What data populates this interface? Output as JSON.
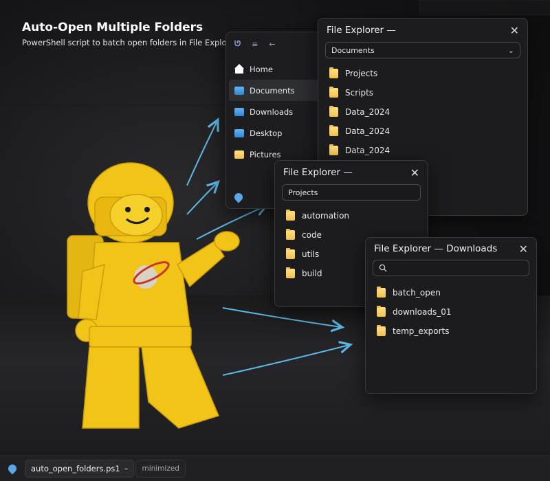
{
  "header": {
    "title": "Auto-Open Multiple Folders",
    "subtitle": "PowerShell script to batch open folders in File Explorer"
  },
  "sidebar": {
    "items": [
      {
        "label": "Home",
        "icon": "home-icon"
      },
      {
        "label": "Documents",
        "icon": "folder-icon"
      },
      {
        "label": "Downloads",
        "icon": "folder-icon"
      },
      {
        "label": "Desktop",
        "icon": "folder-icon"
      },
      {
        "label": "Pictures",
        "icon": "folder-icon"
      }
    ],
    "active": "Documents"
  },
  "win1": {
    "title": "File Explorer —",
    "address": "Documents",
    "items": [
      "Projects",
      "Scripts",
      "Data_2024",
      "Data_2024",
      "Data_2024"
    ]
  },
  "win2": {
    "title": "File Explorer —",
    "address": "Projects",
    "items": [
      "automation",
      "code",
      "utils",
      "build"
    ]
  },
  "win3": {
    "title": "File Explorer — Downloads",
    "address": "",
    "items": [
      "batch_open",
      "downloads_01",
      "temp_exports"
    ]
  },
  "taskbar": {
    "app_label": "auto_open_folders.ps1",
    "app_suffix": "–",
    "status": "minimized"
  },
  "colors": {
    "folder": "#f3c14a",
    "accent": "#5aa8e8",
    "arrow": "#5db8e6",
    "figure": "#f2c418"
  }
}
